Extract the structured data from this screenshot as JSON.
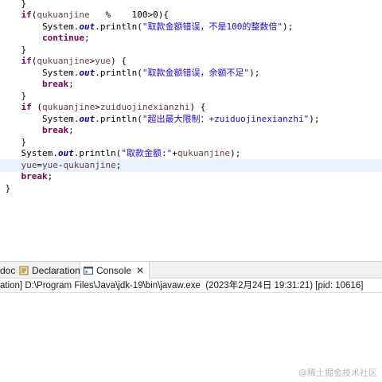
{
  "editor": {
    "lines": [
      [
        {
          "t": "    }",
          "c": "p"
        }
      ],
      [
        {
          "t": "    ",
          "c": "p"
        },
        {
          "t": "if",
          "c": "kw"
        },
        {
          "t": "(",
          "c": "p"
        },
        {
          "t": "qukuanjine",
          "c": "var"
        },
        {
          "t": "   %    100>0){",
          "c": "p"
        }
      ],
      [
        {
          "t": "        System.",
          "c": "p"
        },
        {
          "t": "out",
          "c": "fld"
        },
        {
          "t": ".println(",
          "c": "p"
        },
        {
          "t": "\"取款金额错误，不是100的整数倍\"",
          "c": "str"
        },
        {
          "t": ");",
          "c": "p"
        }
      ],
      [
        {
          "t": "        ",
          "c": "p"
        },
        {
          "t": "continue",
          "c": "kw"
        },
        {
          "t": ";",
          "c": "p"
        }
      ],
      [
        {
          "t": "    }",
          "c": "p"
        }
      ],
      [
        {
          "t": "    ",
          "c": "p"
        },
        {
          "t": "if",
          "c": "kw"
        },
        {
          "t": "(",
          "c": "p"
        },
        {
          "t": "qukuanjine",
          "c": "var"
        },
        {
          "t": ">",
          "c": "p"
        },
        {
          "t": "yue",
          "c": "var"
        },
        {
          "t": ") {",
          "c": "p"
        }
      ],
      [
        {
          "t": "        System.",
          "c": "p"
        },
        {
          "t": "out",
          "c": "fld"
        },
        {
          "t": ".println(",
          "c": "p"
        },
        {
          "t": "\"取款金额错误，余额不足\"",
          "c": "str"
        },
        {
          "t": ");",
          "c": "p"
        }
      ],
      [
        {
          "t": "        ",
          "c": "p"
        },
        {
          "t": "break",
          "c": "kw"
        },
        {
          "t": ";",
          "c": "p"
        }
      ],
      [
        {
          "t": "    }",
          "c": "p"
        }
      ],
      [
        {
          "t": "    ",
          "c": "p"
        },
        {
          "t": "if",
          "c": "kw"
        },
        {
          "t": " (",
          "c": "p"
        },
        {
          "t": "qukuanjine",
          "c": "var"
        },
        {
          "t": ">",
          "c": "p"
        },
        {
          "t": "zuiduojinexianzhi",
          "c": "var"
        },
        {
          "t": ") {",
          "c": "p"
        }
      ],
      [
        {
          "t": "        System.",
          "c": "p"
        },
        {
          "t": "out",
          "c": "fld"
        },
        {
          "t": ".println(",
          "c": "p"
        },
        {
          "t": "\"超出最大限制：+zuiduojinexianzhi\"",
          "c": "str"
        },
        {
          "t": ");",
          "c": "p"
        }
      ],
      [
        {
          "t": "        ",
          "c": "p"
        },
        {
          "t": "break",
          "c": "kw"
        },
        {
          "t": ";",
          "c": "p"
        }
      ],
      [
        {
          "t": "    }",
          "c": "p"
        }
      ],
      [
        {
          "t": "    System.",
          "c": "p"
        },
        {
          "t": "out",
          "c": "fld"
        },
        {
          "t": ".println(",
          "c": "p"
        },
        {
          "t": "\"取款金额:\"",
          "c": "str"
        },
        {
          "t": "+",
          "c": "p"
        },
        {
          "t": "qukuanjine",
          "c": "var"
        },
        {
          "t": ");",
          "c": "p"
        }
      ],
      [
        {
          "t": "    ",
          "c": "p"
        },
        {
          "t": "yue",
          "c": "var"
        },
        {
          "t": "=",
          "c": "p"
        },
        {
          "t": "yue",
          "c": "var"
        },
        {
          "t": "-",
          "c": "p"
        },
        {
          "t": "qukuanjine",
          "c": "var"
        },
        {
          "t": ";",
          "c": "p"
        }
      ],
      [
        {
          "t": "    ",
          "c": "p"
        },
        {
          "t": "break",
          "c": "kw"
        },
        {
          "t": ";",
          "c": "p"
        }
      ],
      [
        {
          "t": " }",
          "c": "p"
        }
      ]
    ]
  },
  "panel": {
    "tabs": [
      {
        "label": "doc",
        "icon": "javadoc-icon",
        "active": false
      },
      {
        "label": "Declaration",
        "icon": "declaration-icon",
        "active": false
      },
      {
        "label": "Console",
        "icon": "console-icon",
        "active": true,
        "close": "✕"
      }
    ],
    "status_text": "ation] D:\\Program Files\\Java\\jdk-19\\bin\\javaw.exe  (2023年2月24日 19:31:21) [pid: 10616]"
  },
  "watermark": "@稀土掘金技术社区",
  "colors": {
    "keyword": "#7f0055",
    "variable": "#6a3e3e",
    "field": "#0000c0",
    "string": "#2a00ff",
    "current_line": "#e8f2fe"
  }
}
